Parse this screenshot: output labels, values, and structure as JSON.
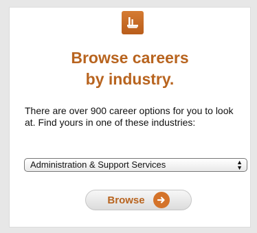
{
  "widget": {
    "heading_line1": "Browse careers",
    "heading_line2": "by industry.",
    "description": "There are over 900 career options for you to look at. Find yours in one of these industries:",
    "industry_select": {
      "selected": "Administration & Support Services"
    },
    "browse_button": {
      "label": "Browse"
    }
  },
  "icons": {
    "logo": "industry-icon",
    "select_arrows": "updown-arrows-icon",
    "browse": "arrow-right-circle-icon"
  },
  "colors": {
    "accent": "#b8641f",
    "badge": "#d07630",
    "page_background": "#e7e7e7",
    "card_background": "#ffffff"
  }
}
